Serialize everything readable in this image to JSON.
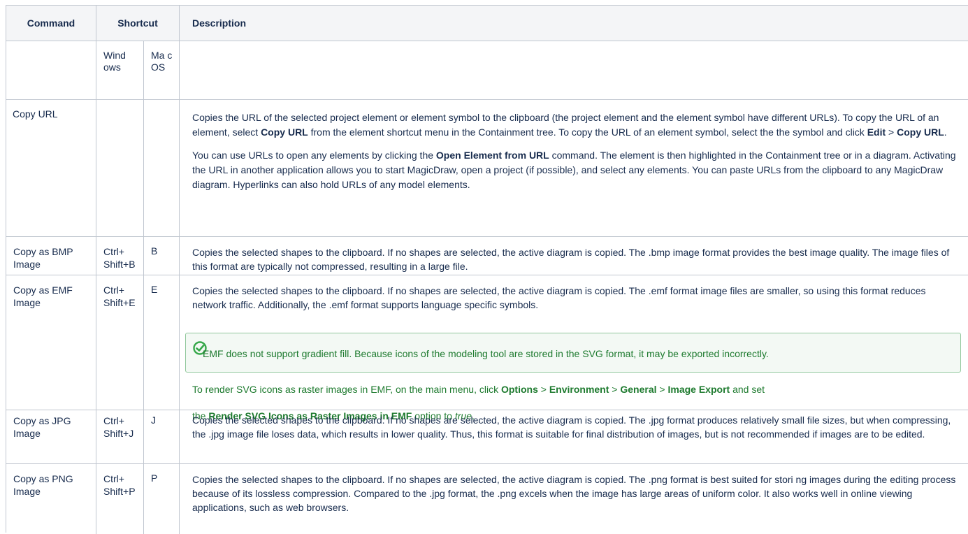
{
  "columns": {
    "command": "Command",
    "shortcut": "Shortcut",
    "description": "Description",
    "windows": "Wind ows",
    "mac": "Ma c OS"
  },
  "rows": [
    {
      "command": "Copy URL",
      "windows": "",
      "mac": "",
      "desc1_a": "Copies the URL of the selected project element or element symbol to the clipboard (the project element and the element symbol have different URLs). To copy the URL of an element, select ",
      "desc1_b": "Copy URL",
      "desc1_c": " from the element shortcut menu in the Containment tree. To copy the URL of an element symbol, select the the symbol and click ",
      "desc1_d": "Edit",
      "desc1_e": " > ",
      "desc1_f": "Copy URL",
      "desc1_g": ".",
      "desc2_a": "You can use URLs to open any elements by clicking the ",
      "desc2_b": "Open Element from URL",
      "desc2_c": " command. The element is then highlighted in the Containment tree or in a diagram. Activating the URL in another application allows you to start MagicDraw, open a project (if possible), and select any elements. You can paste URLs from the clipboard to any MagicDraw diagram. Hyperlinks can also hold URLs of any model elements."
    },
    {
      "command": "Copy as BMP Image",
      "windows": "Ctrl+ Shift+B",
      "mac": "B",
      "desc": "Copies the selected shapes to the clipboard. If no shapes are selected, the active diagram is copied. The .bmp image format provides the best image quality. The image files of this format are typically not compressed, resulting in a large file."
    },
    {
      "command": "Copy as EMF Image",
      "windows": "Ctrl+ Shift+E",
      "mac": "E",
      "desc": "Copies the selected shapes to the clipboard. If no shapes are selected, the active diagram is copied. The .emf format image files are smaller, so using this format reduces network traffic. Additionally, the .emf format supports language specific symbols.",
      "note": "EMF does not support gradient fill. Because icons of the modeling tool are stored in the SVG format, it may be exported incorrectly.",
      "note2_a": "To render SVG icons as raster images in EMF, on the main menu, click ",
      "note2_b": "Options",
      "note2_c": " > ",
      "note2_d": "Environment",
      "note2_e": " > ",
      "note2_f": "General",
      "note2_g": " > ",
      "note2_h": "Image Export",
      "note2_i": " and set",
      "note3_a": "the ",
      "note3_b": "Render SVG Icons as Raster Images in EMF",
      "note3_c": " option to ",
      "note3_d": "true",
      "note3_e": "."
    },
    {
      "command": "Copy as JPG Image",
      "windows": "Ctrl+ Shift+J",
      "mac": "J",
      "desc": "Copies the selected shapes to the clipboard. If no shapes are selected, the active diagram is copied. The .jpg format produces relatively small file sizes, but when compressing, the .jpg image file loses data, which results in lower quality. Thus, this format is suitable for final distribution of images, but is not recommended if images are to be edited."
    },
    {
      "command": "Copy as PNG Image",
      "windows": "Ctrl+ Shift+P",
      "mac": "P",
      "desc": "Copies the selected shapes to the clipboard. If no shapes are selected, the active diagram is copied. The .png format is best suited for stori ng images during the editing process because of its lossless compression. Compared to the .jpg format, the .png excels when the image has large areas of uniform color. It also works well in online viewing applications, such as web browsers."
    }
  ]
}
